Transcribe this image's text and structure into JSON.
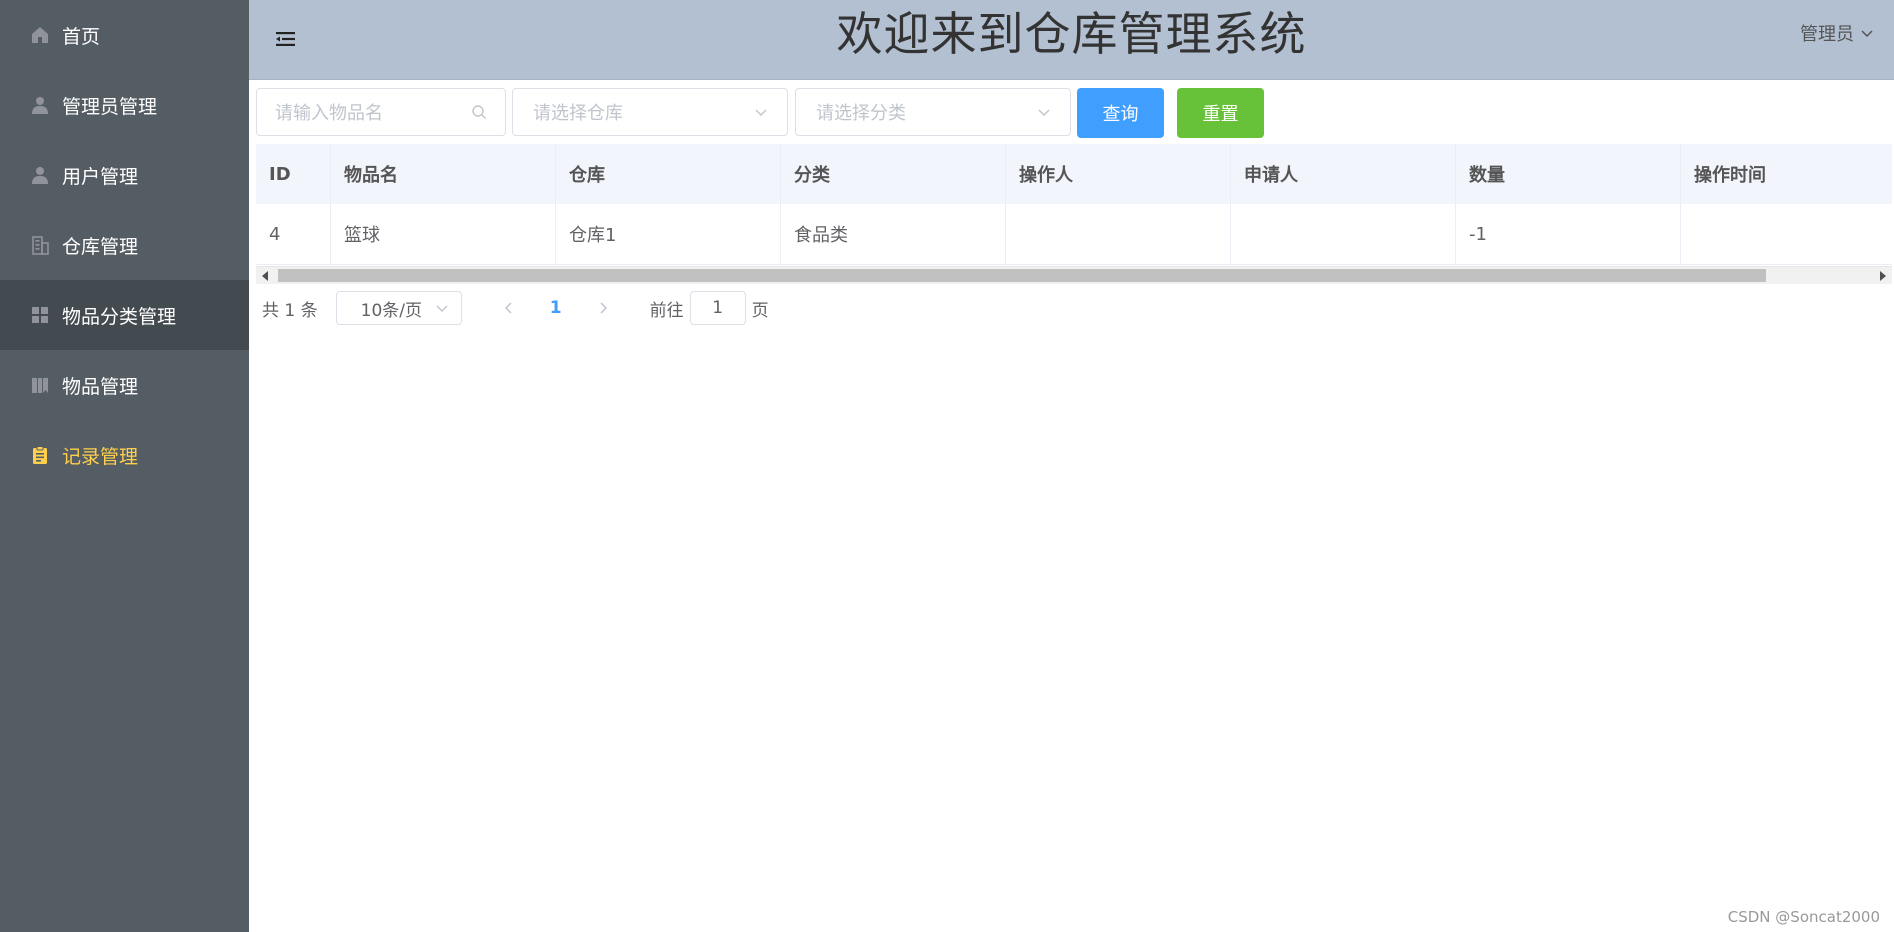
{
  "header": {
    "title": "欢迎来到仓库管理系统",
    "user_label": "管理员"
  },
  "sidebar": {
    "items": [
      {
        "label": "首页",
        "icon": "home-icon"
      },
      {
        "label": "管理员管理",
        "icon": "user-icon"
      },
      {
        "label": "用户管理",
        "icon": "user-icon"
      },
      {
        "label": "仓库管理",
        "icon": "building-icon"
      },
      {
        "label": "物品分类管理",
        "icon": "grid-icon"
      },
      {
        "label": "物品管理",
        "icon": "goods-icon"
      },
      {
        "label": "记录管理",
        "icon": "clipboard-icon"
      }
    ],
    "selected_bg_index": 4,
    "active_index": 6,
    "active_color": "#ffd04b",
    "background_color": "#545c64"
  },
  "filters": {
    "name_placeholder": "请输入物品名",
    "storage_placeholder": "请选择仓库",
    "category_placeholder": "请选择分类",
    "query_label": "查询",
    "reset_label": "重置"
  },
  "table": {
    "columns": [
      "ID",
      "物品名",
      "仓库",
      "分类",
      "操作人",
      "申请人",
      "数量",
      "操作时间"
    ],
    "rows": [
      [
        "4",
        "篮球",
        "仓库1",
        "食品类",
        "",
        "",
        "-1",
        ""
      ]
    ]
  },
  "pagination": {
    "total": "共 1 条",
    "page_size": "10条/页",
    "current_page": "1",
    "goto_label": "前往",
    "goto_value": "1",
    "page_suffix": "页"
  },
  "watermark": "CSDN @Soncat2000"
}
